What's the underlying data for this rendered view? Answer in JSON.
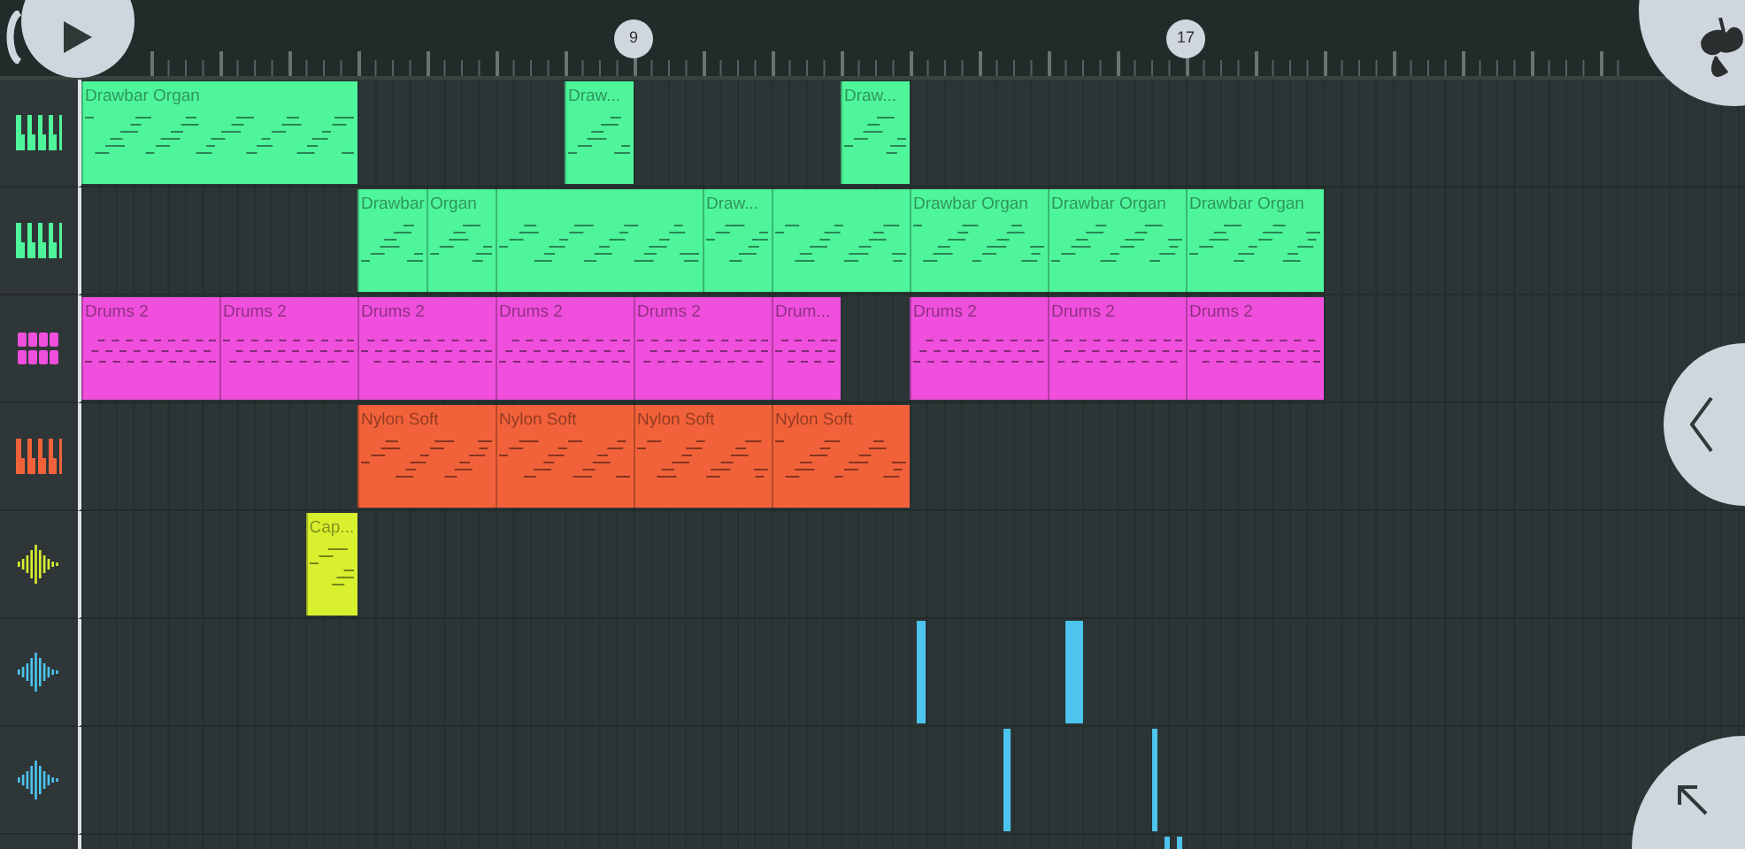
{
  "ruler": {
    "markers": [
      {
        "label": "9"
      },
      {
        "label": "17"
      }
    ]
  },
  "tracks": [
    {
      "kind": "keys",
      "color": "#4ef59a",
      "clips": [
        {
          "label": "Drawbar Organ"
        },
        {
          "label": "Draw..."
        },
        {
          "label": "Draw..."
        }
      ]
    },
    {
      "kind": "keys",
      "color": "#4ef59a",
      "clips": [
        {
          "label": "Drawbar"
        },
        {
          "label": "Organ"
        },
        {
          "kind": "unlabeled"
        },
        {
          "label": "Draw..."
        },
        {
          "kind": "unlabeled"
        },
        {
          "label": "Drawbar Organ"
        },
        {
          "label": "Drawbar Organ"
        },
        {
          "label": "Drawbar Organ"
        }
      ]
    },
    {
      "kind": "drums",
      "color": "#ef4fdc",
      "clips": [
        {
          "label": "Drums 2"
        },
        {
          "label": "Drums 2"
        },
        {
          "label": "Drums 2"
        },
        {
          "label": "Drums 2"
        },
        {
          "label": "Drums 2"
        },
        {
          "label": "Drum..."
        },
        {
          "label": "Drums 2"
        },
        {
          "label": "Drums 2"
        },
        {
          "label": "Drums 2"
        }
      ]
    },
    {
      "kind": "keys",
      "color": "#f2623a",
      "clips": [
        {
          "label": "Nylon Soft"
        },
        {
          "label": "Nylon Soft"
        },
        {
          "label": "Nylon Soft"
        },
        {
          "label": "Nylon Soft"
        }
      ]
    },
    {
      "kind": "audio",
      "color": "#d9f02e",
      "clips": [
        {
          "label": "Cap..."
        }
      ]
    },
    {
      "kind": "audio",
      "color": "#4cc4ee",
      "clips": [
        {
          "kind": "audio"
        },
        {
          "kind": "audio"
        }
      ]
    },
    {
      "kind": "audio",
      "color": "#4cc4ee",
      "clips": [
        {
          "kind": "audio"
        },
        {
          "kind": "audio"
        }
      ]
    },
    {
      "color": "#4cc4ee",
      "clips": [
        {
          "kind": "audio"
        },
        {
          "kind": "audio"
        }
      ]
    }
  ]
}
